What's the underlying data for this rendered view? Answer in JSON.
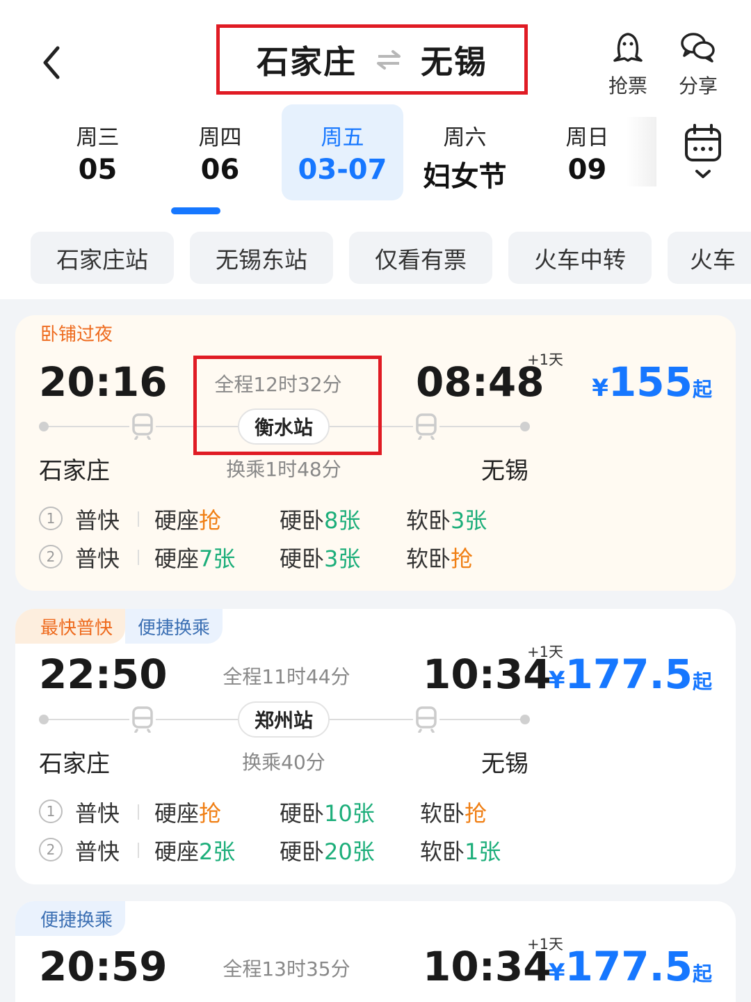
{
  "header": {
    "from": "石家庄",
    "to": "无锡",
    "grab_label": "抢票",
    "share_label": "分享"
  },
  "dates": [
    {
      "weekday": "周三",
      "day": "05"
    },
    {
      "weekday": "周四",
      "day": "06"
    },
    {
      "weekday": "周五",
      "day": "03-07"
    },
    {
      "weekday": "周六",
      "day": "妇女节"
    },
    {
      "weekday": "周日",
      "day": "09"
    }
  ],
  "active_date_index": 2,
  "filters": [
    "石家庄站",
    "无锡东站",
    "仅看有票",
    "火车中转",
    "火车"
  ],
  "results": [
    {
      "tags": [
        "卧铺过夜"
      ],
      "dep_time": "20:16",
      "arr_time": "08:48",
      "plus_day": "+1天",
      "duration": "全程12时32分",
      "via": "衡水站",
      "transfer": "换乘1时48分",
      "from_city": "石家庄",
      "to_city": "无锡",
      "price_currency": "¥",
      "price": "155",
      "price_suffix": "起",
      "legs": [
        {
          "num": "1",
          "type": "普快",
          "seats": [
            {
              "name": "硬座",
              "status": "抢"
            },
            {
              "name": "硬卧",
              "status": "8张"
            },
            {
              "name": "软卧",
              "status": "3张"
            }
          ]
        },
        {
          "num": "2",
          "type": "普快",
          "seats": [
            {
              "name": "硬座",
              "status": "7张"
            },
            {
              "name": "硬卧",
              "status": "3张"
            },
            {
              "name": "软卧",
              "status": "抢"
            }
          ]
        }
      ]
    },
    {
      "tags": [
        "最快普快",
        "便捷换乘"
      ],
      "dep_time": "22:50",
      "arr_time": "10:34",
      "plus_day": "+1天",
      "duration": "全程11时44分",
      "via": "郑州站",
      "transfer": "换乘40分",
      "from_city": "石家庄",
      "to_city": "无锡",
      "price_currency": "¥",
      "price": "177.5",
      "price_suffix": "起",
      "legs": [
        {
          "num": "1",
          "type": "普快",
          "seats": [
            {
              "name": "硬座",
              "status": "抢"
            },
            {
              "name": "硬卧",
              "status": "10张"
            },
            {
              "name": "软卧",
              "status": "抢"
            }
          ]
        },
        {
          "num": "2",
          "type": "普快",
          "seats": [
            {
              "name": "硬座",
              "status": "2张"
            },
            {
              "name": "硬卧",
              "status": "20张"
            },
            {
              "name": "软卧",
              "status": "1张"
            }
          ]
        }
      ]
    },
    {
      "tags": [
        "便捷换乘"
      ],
      "dep_time": "20:59",
      "arr_time": "10:34",
      "plus_day": "+1天",
      "duration": "全程13时35分",
      "price_currency": "¥",
      "price": "177.5",
      "price_suffix": "起"
    }
  ],
  "colors": {
    "accent_blue": "#1677ff",
    "highlight_red": "#e01b24",
    "available_green": "#1cae7a",
    "grab_orange": "#f07f14",
    "tag_orange": "#ee6a1d"
  }
}
